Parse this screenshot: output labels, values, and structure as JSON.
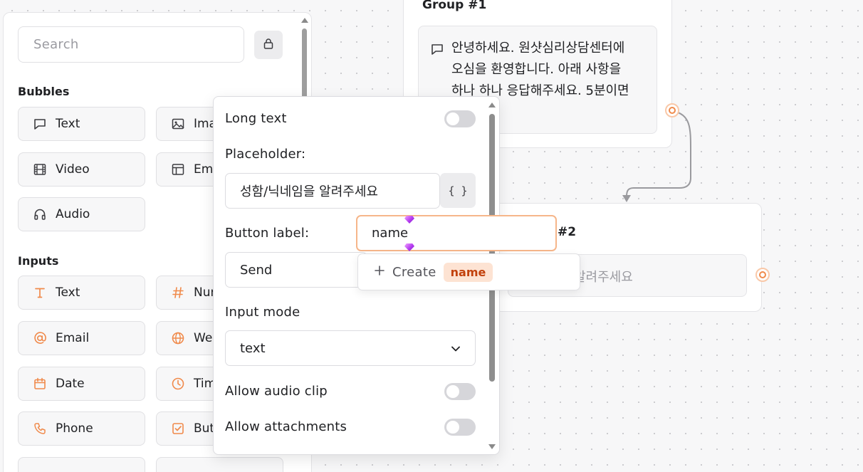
{
  "canvas": {
    "group1": {
      "title": "Group #1",
      "text_bubble": "안녕하세요. 원샷심리상담센터에 오심을 환영합니다. 아래 사항을 하나 하나 응답해주세요. 5분이면"
    },
    "group2": {
      "title": "#2",
      "input_placeholder": "닉네임을 알려주세요"
    }
  },
  "sidebar": {
    "search_placeholder": "Search",
    "lock_icon": "lock-icon",
    "bubbles_title": "Bubbles",
    "bubbles": [
      {
        "label": "Text",
        "icon": "chat-bubble-icon"
      },
      {
        "label": "Ima",
        "icon": "image-icon"
      },
      {
        "label": "Video",
        "icon": "film-icon"
      },
      {
        "label": "Em",
        "icon": "embed-icon"
      },
      {
        "label": "Audio",
        "icon": "headphones-icon"
      }
    ],
    "inputs_title": "Inputs",
    "inputs": [
      {
        "label": "Text",
        "icon": "text-t-icon"
      },
      {
        "label": "Nur",
        "icon": "hash-icon"
      },
      {
        "label": "Email",
        "icon": "at-icon"
      },
      {
        "label": "Web",
        "icon": "globe-icon"
      },
      {
        "label": "Date",
        "icon": "calendar-icon"
      },
      {
        "label": "Tim",
        "icon": "clock-icon"
      },
      {
        "label": "Phone",
        "icon": "phone-icon"
      },
      {
        "label": "But",
        "icon": "checkbox-icon"
      }
    ]
  },
  "popover": {
    "long_text_label": "Long text",
    "long_text_on": false,
    "placeholder_label": "Placeholder:",
    "placeholder_value": "성함/닉네임을 알려주세요",
    "variable_button": "{ }",
    "button_label_label": "Button label:",
    "button_label_value": "Send",
    "input_mode_label": "Input mode",
    "input_mode_value": "text",
    "allow_audio_label": "Allow audio clip",
    "allow_audio_on": false,
    "allow_attachments_label": "Allow attachments",
    "allow_attachments_on": false
  },
  "variable_dropdown": {
    "input_value": "name",
    "create_label": "Create",
    "create_chip": "name"
  },
  "colors": {
    "accent_orange": "#f08a4b",
    "chip_bg": "#fde3d3",
    "chip_text": "#c2410c",
    "canvas_bg": "#f7f7f8"
  }
}
